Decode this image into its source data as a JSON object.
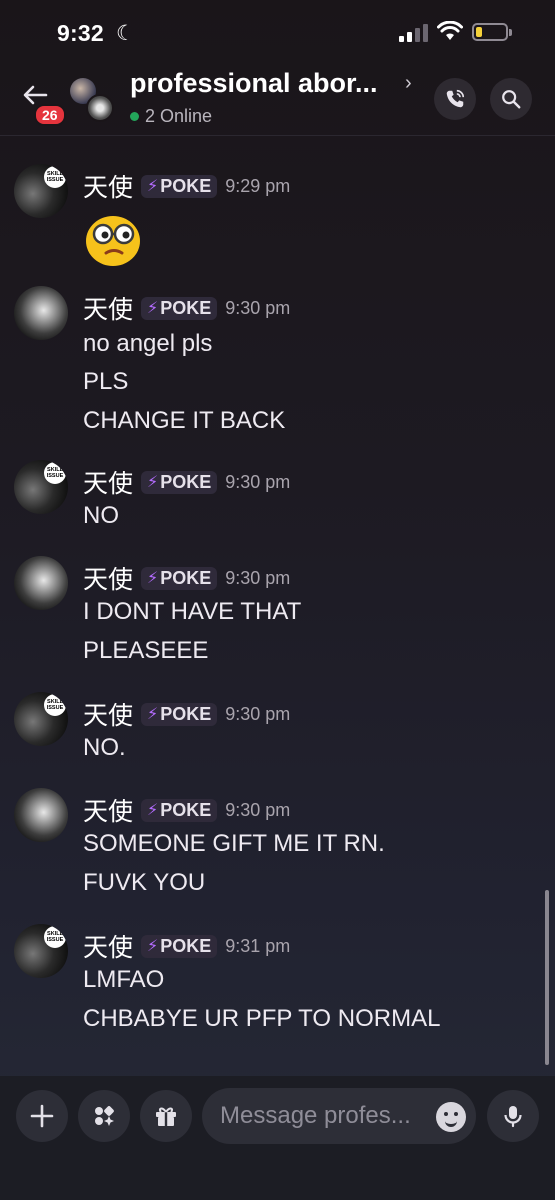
{
  "status_bar": {
    "time": "9:32",
    "focus_icon": "moon-icon",
    "signal_bars": 2,
    "battery_level": 0.15
  },
  "header": {
    "back_badge": "26",
    "title": "professional abor...",
    "online_status": "2 Online"
  },
  "messages": [
    {
      "user": "天使",
      "tag": "POKE",
      "time": "9:29 pm",
      "avatar": "skill-issue",
      "lines": [],
      "emoji": "nerd-face"
    },
    {
      "user": "天使",
      "tag": "POKE",
      "time": "9:30 pm",
      "avatar": "moon",
      "lines": [
        "no angel pls",
        "PLS",
        "CHANGE IT BACK"
      ]
    },
    {
      "user": "天使",
      "tag": "POKE",
      "time": "9:30 pm",
      "avatar": "skill-issue",
      "lines": [
        "NO"
      ]
    },
    {
      "user": "天使",
      "tag": "POKE",
      "time": "9:30 pm",
      "avatar": "moon",
      "lines": [
        "I DONT HAVE THAT",
        "PLEASEEE"
      ]
    },
    {
      "user": "天使",
      "tag": "POKE",
      "time": "9:30 pm",
      "avatar": "skill-issue",
      "lines": [
        "NO."
      ]
    },
    {
      "user": "天使",
      "tag": "POKE",
      "time": "9:30 pm",
      "avatar": "moon",
      "lines": [
        "SOMEONE GIFT ME IT RN.",
        "FUVK YOU"
      ]
    },
    {
      "user": "天使",
      "tag": "POKE",
      "time": "9:31 pm",
      "avatar": "skill-issue",
      "lines": [
        "LMFAO",
        "CHBABYE UR PFP TO NORMAL"
      ]
    }
  ],
  "avatar_tag_text": "SKILL ISSUE",
  "input": {
    "placeholder": "Message profes..."
  },
  "colors": {
    "online": "#23a55a",
    "badge": "#e5343d",
    "poke_bolt": "#b46cff"
  }
}
